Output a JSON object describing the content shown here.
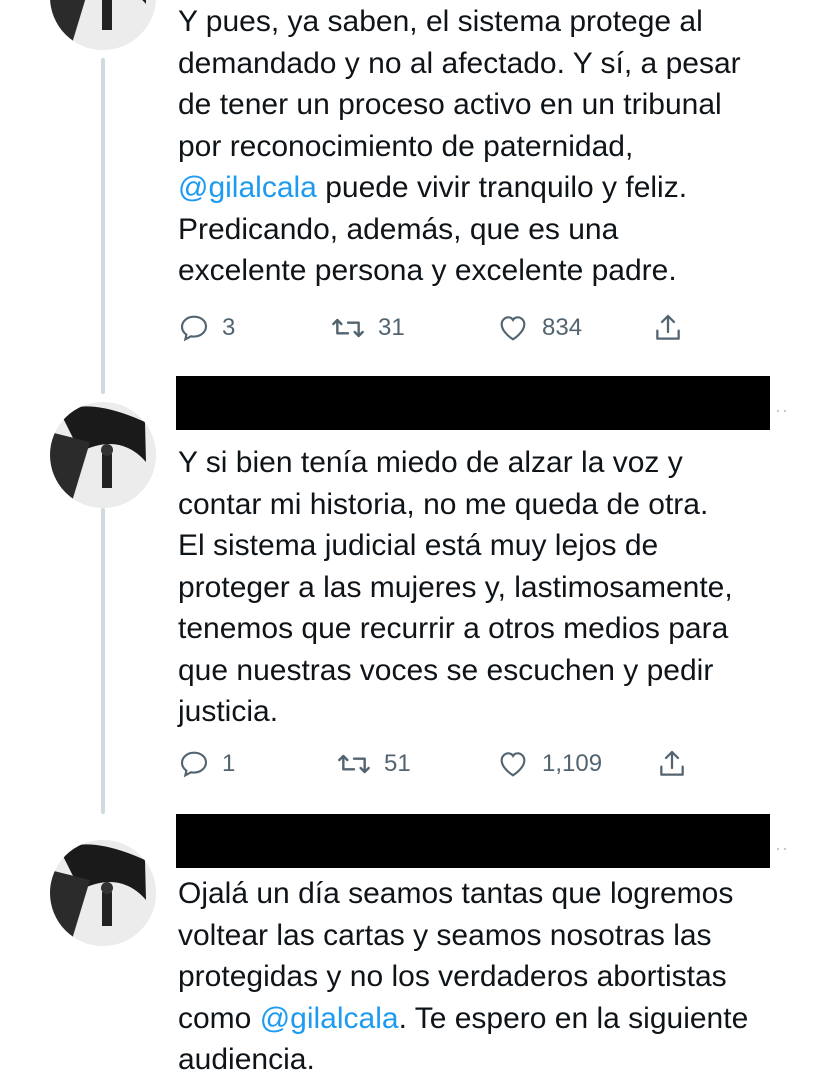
{
  "tweets": [
    {
      "text_parts": [
        "Y pues, ya saben, el sistema protege al\ndemandado y no al afectado. Y sí, a pesar\nde tener un proceso activo en un tribunal\npor reconocimiento de paternidad,\n",
        "@gilalcala",
        " puede vivir tranquilo y feliz.\nPredicando, además, que es una\nexcelente persona y excelente padre."
      ],
      "replies": "3",
      "retweets": "31",
      "likes": "834"
    },
    {
      "text_parts": [
        "Y si bien tenía miedo de alzar la voz y\ncontar mi historia, no me queda de otra.\nEl sistema judicial está muy lejos de\nproteger a las mujeres y, lastimosamente,\ntenemos que recurrir a otros medios para\nque nuestras voces se escuchen y pedir\njusticia."
      ],
      "replies": "1",
      "retweets": "51",
      "likes": "1,109"
    },
    {
      "text_parts": [
        "Ojalá un día seamos tantas que logremos\nvoltear las cartas y seamos nosotras las\nprotegidas y no los verdaderos abortistas\ncomo ",
        "@gilalcala",
        ". Te espero en la siguiente\naudiencia."
      ]
    }
  ],
  "icons": {
    "reply": "reply-icon",
    "retweet": "retweet-icon",
    "like": "heart-icon",
    "share": "share-icon",
    "more": "more-icon"
  },
  "colors": {
    "mention": "#1d9bf0",
    "action": "#536471",
    "thread_line": "#cfd9de",
    "text": "#0f1419"
  }
}
